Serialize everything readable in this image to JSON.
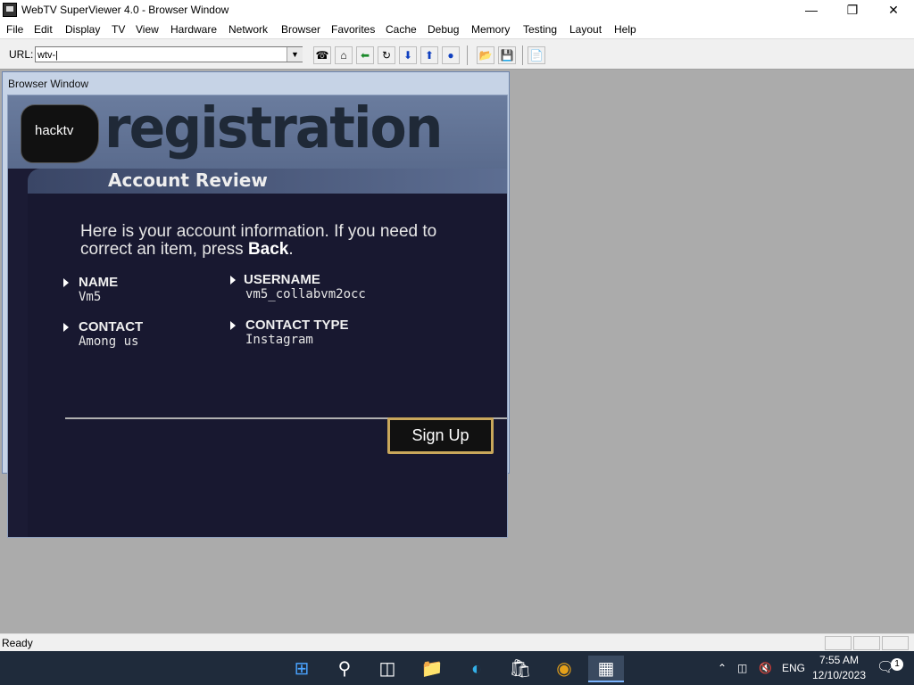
{
  "window": {
    "title": "WebTV SuperViewer 4.0 - Browser Window"
  },
  "menu": [
    "File",
    "Edit",
    "Display",
    "TV",
    "View",
    "Hardware",
    "Network",
    "Browser",
    "Favorites",
    "Cache",
    "Debug",
    "Memory",
    "Testing",
    "Layout",
    "Help"
  ],
  "toolbar": {
    "url_label": "URL:",
    "url_value": "wtv-|"
  },
  "browser": {
    "title": "Browser Window",
    "logo_text": "hacktv",
    "page_title": "registration",
    "section_title": "Account Review",
    "intro_text": "Here is your account information. If you need to correct an item, press ",
    "intro_bold": "Back",
    "intro_end": ".",
    "fields": [
      {
        "label": "NAME",
        "value": "Vm5"
      },
      {
        "label": "USERNAME",
        "value": "vm5_collabvm2occ"
      },
      {
        "label": "CONTACT",
        "value": "Among us"
      },
      {
        "label": "CONTACT TYPE",
        "value": "Instagram"
      }
    ],
    "signup_label": "Sign Up"
  },
  "status": {
    "text": "Ready"
  },
  "taskbar": {
    "language": "ENG",
    "time": "7:55 AM",
    "date": "12/10/2023",
    "notification_count": "1"
  },
  "colors": {
    "page_bg": "#1b1b34",
    "header": "#5a6b8d",
    "button_border": "#c9a75b"
  }
}
